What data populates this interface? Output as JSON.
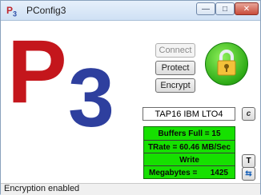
{
  "window": {
    "title": "PConfig3",
    "icon_p": "P",
    "icon_3": "3"
  },
  "logo": {
    "p": "P",
    "three": "3",
    "p_color": "#c4161c",
    "three_color": "#2e3f9e"
  },
  "buttons": {
    "connect": "Connect",
    "protect": "Protect",
    "encrypt": "Encrypt"
  },
  "lock": {
    "state": "locked",
    "icon": "lock-icon"
  },
  "tape": {
    "label": "TAP16 IBM LTO4",
    "c_button": "c"
  },
  "status_panel": {
    "buffers_full": "Buffers Full = 15",
    "trate": "TRate = 60.46 MB/Sec",
    "mode": "Write",
    "megabytes_label": "Megabytes =",
    "megabytes_value": "1425"
  },
  "side_buttons": {
    "t": "T"
  },
  "statusbar": {
    "text": "Encryption enabled"
  }
}
